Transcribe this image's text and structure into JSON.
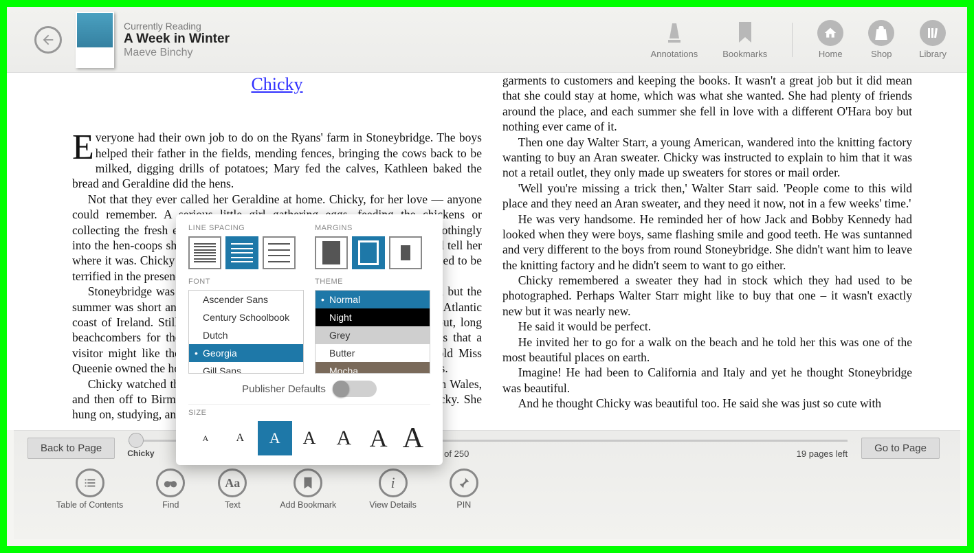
{
  "header": {
    "currently_reading_label": "Currently Reading",
    "book_title": "A Week in Winter",
    "author": "Maeve Binchy",
    "actions": {
      "annotations": "Annotations",
      "bookmarks": "Bookmarks",
      "home": "Home",
      "shop": "Shop",
      "library": "Library"
    }
  },
  "reader": {
    "chapter_title": "Chicky",
    "left_paragraphs": [
      "veryone had their own job to do on the Ryans' farm in Stoneybridge. The boys helped their father in the fields, mending fences, bringing the cows back to be milked, digging drills of potatoes; Mary fed the calves, Kathleen baked the bread and Geraldine did the hens.",
      "Not that they ever called her Geraldine at home. Chicky, for her love — anyone could remember. A serious little girl gathering eggs, feeding the chickens or collecting the fresh eggs, always saying unconvincingly: 'chuck chuck' soothingly into the hen-coops she was making sure none of the hens, and no one could tell her where it was. Chicky always brought them a fry lunch. They always pretended to be terrified in the presence of cows.",
      "Stoneybridge was a paradise for children who came during the summer, but the summer was short and the rest of the year long and wild and lonely on the Atlantic coast of Ireland. Still there were the cliffs to climb, birds' nests to seek out, long beachcombers for the thorns to investigate. And there were all the things that a visitor might like the huge overgrown garden at the Big Stone, where old Miss Queenie owned the house, and were always delighted to welcome the visitors.",
      "Chicky watched the people she was at school with, nursing in hospital in Wales, and then off to Birmingham to work. None of those jobs appealed to Chicky. She hung on, studying, and when she left the land"
    ],
    "right_paragraphs": [
      "garments to customers and keeping the books. It wasn't a great job but it did mean that she could stay at home, which was what she wanted. She had plenty of friends around the place, and each summer she fell in love with a different O'Hara boy but nothing ever came of it.",
      "Then one day Walter Starr, a young American, wandered into the knitting factory wanting to buy an Aran sweater. Chicky was instructed to explain to him that it was not a retail outlet, they only made up sweaters for stores or mail order.",
      "'Well you're missing a trick then,' Walter Starr said. 'People come to this wild place and they need an Aran sweater, and they need it now, not in a few weeks' time.'",
      "He was very handsome. He reminded her of how Jack and Bobby Kennedy had looked when they were boys, same flashing smile and good teeth. He was suntanned and very different to the boys from round Stoneybridge. She didn't want him to leave the knitting factory and he didn't seem to want to go either.",
      "Chicky remembered a sweater they had in stock which they had used to be photographed. Perhaps Walter Starr might like to buy that one – it wasn't exactly new but it was nearly new.",
      "He said it would be perfect.",
      "He invited her to go for a walk on the beach and he told her this was one of the most beautiful places on earth.",
      "Imagine! He had been to California and Italy and yet he thought Stoneybridge was beautiful.",
      "And he thought Chicky was beautiful too. He said she was just so cute with"
    ]
  },
  "settings": {
    "line_spacing_label": "LINE SPACING",
    "margins_label": "MARGINS",
    "font_label": "FONT",
    "theme_label": "THEME",
    "publisher_defaults_label": "Publisher Defaults",
    "size_label": "SIZE",
    "fonts": [
      "Ascender Sans",
      "Century Schoolbook",
      "Dutch",
      "Georgia",
      "Gill Sans"
    ],
    "font_selected": "Georgia",
    "themes": [
      "Normal",
      "Night",
      "Grey",
      "Butter",
      "Mocha"
    ],
    "theme_selected": "Normal",
    "line_spacing_selected": 1,
    "margin_selected": 1,
    "size_selected": 2,
    "publisher_defaults_on": false
  },
  "footer": {
    "back_to_page_label": "Back to Page",
    "go_to_page_label": "Go to Page",
    "chapter_name": "Chicky",
    "page_info": "5 of 250",
    "pages_left": "19 pages left",
    "tools": {
      "toc": "Table of Contents",
      "find": "Find",
      "text": "Text",
      "add_bookmark": "Add Bookmark",
      "view_details": "View Details",
      "pin": "PIN"
    }
  }
}
